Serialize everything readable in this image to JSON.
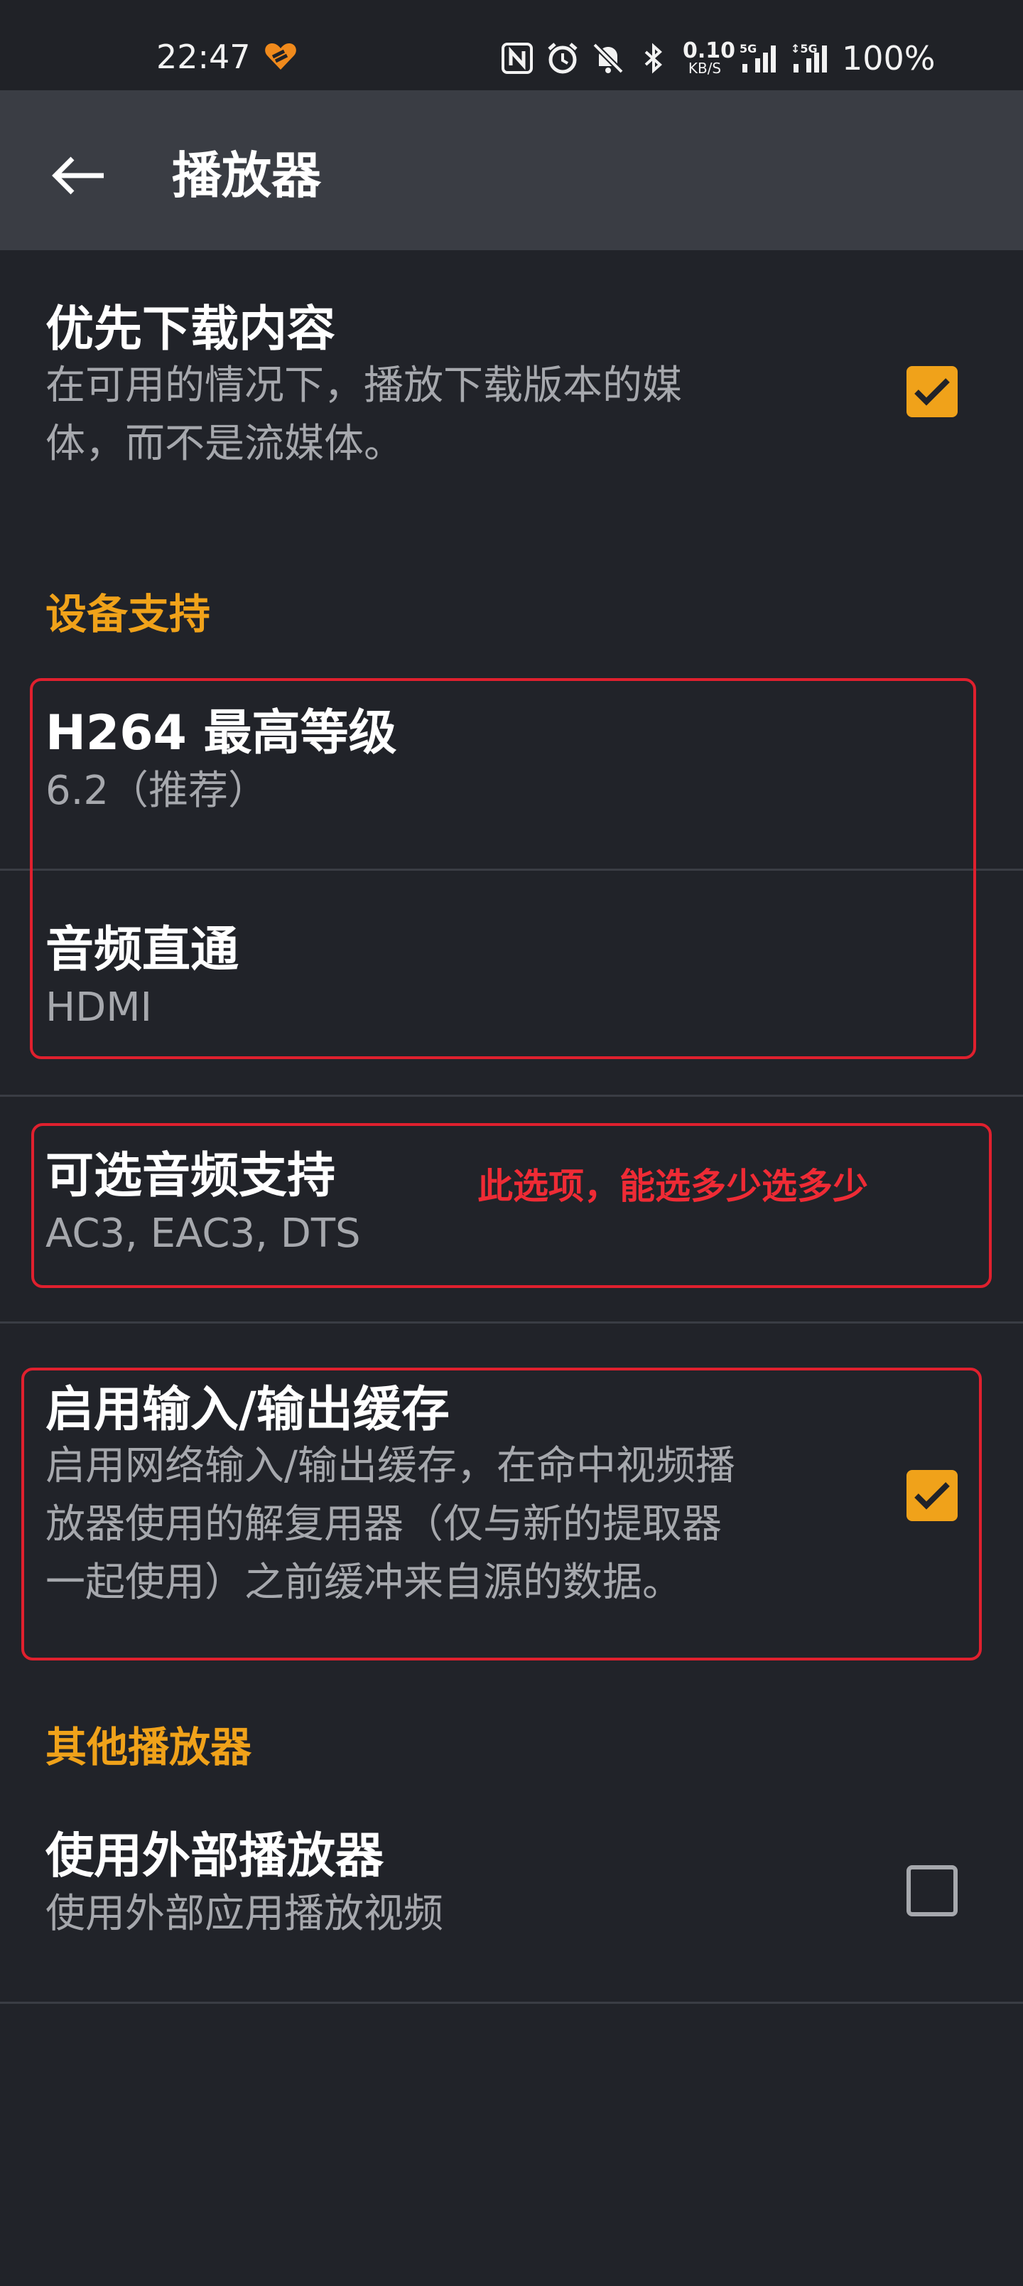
{
  "status_bar": {
    "time": "22:47",
    "net_speed_top": "0.10",
    "net_speed_bottom": "KB/S",
    "battery": "100%",
    "icons": [
      "heart-icon",
      "nfc-icon",
      "alarm-icon",
      "mute-icon",
      "bluetooth-icon",
      "signal-5g-icon",
      "signal-5g-icon-2"
    ]
  },
  "app_bar": {
    "title": "播放器",
    "back_icon": "arrow-left-icon"
  },
  "settings": {
    "prefer_download": {
      "title": "优先下载内容",
      "subtitle_line1": "在可用的情况下，播放下载版本的媒",
      "subtitle_line2": "体，而不是流媒体。",
      "checked": true
    },
    "section_device": "设备支持",
    "h264": {
      "title": "H264 最高等级",
      "subtitle": "6.2（推荐）"
    },
    "audio_passthrough": {
      "title": "音频直通",
      "subtitle": "HDMI"
    },
    "optional_audio": {
      "title": "可选音频支持",
      "subtitle": "AC3, EAC3, DTS"
    },
    "io_cache": {
      "title": "启用输入/输出缓存",
      "subtitle_line1": "启用网络输入/输出缓存，在命中视频播",
      "subtitle_line2": "放器使用的解复用器（仅与新的提取器",
      "subtitle_line3": "一起使用）之前缓冲来自源的数据。",
      "checked": true
    },
    "section_other": "其他播放器",
    "external_player": {
      "title": "使用外部播放器",
      "subtitle": "使用外部应用播放视频",
      "checked": false
    }
  },
  "annotation": {
    "note": "此选项，能选多少选多少",
    "color": "#e0202e"
  },
  "colors": {
    "background": "#212329",
    "appbar": "#3a3d44",
    "accent": "#f0a21a",
    "subtitle": "#a6a8ad"
  }
}
